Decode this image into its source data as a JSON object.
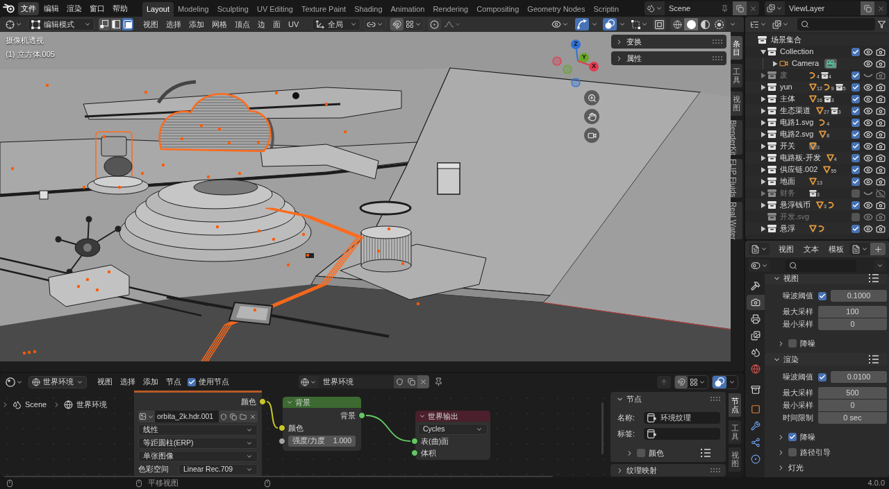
{
  "topbar": {
    "menus": [
      {
        "label": "文件",
        "selected": true
      },
      {
        "label": "编辑",
        "selected": false
      },
      {
        "label": "渲染",
        "selected": false
      },
      {
        "label": "窗口",
        "selected": false
      },
      {
        "label": "帮助",
        "selected": false
      }
    ],
    "workspaces": [
      {
        "label": "Layout",
        "selected": true
      },
      {
        "label": "Modeling",
        "selected": false
      },
      {
        "label": "Sculpting",
        "selected": false
      },
      {
        "label": "UV Editing",
        "selected": false
      },
      {
        "label": "Texture Paint",
        "selected": false
      },
      {
        "label": "Shading",
        "selected": false
      },
      {
        "label": "Animation",
        "selected": false
      },
      {
        "label": "Rendering",
        "selected": false
      },
      {
        "label": "Compositing",
        "selected": false
      },
      {
        "label": "Geometry Nodes",
        "selected": false
      },
      {
        "label": "Scriptin",
        "selected": false
      }
    ],
    "scene": "Scene",
    "view_layer": "ViewLayer"
  },
  "viewport": {
    "header": {
      "mode": "编辑模式",
      "select_modes": [
        {
          "kind": "vertex",
          "selected": false
        },
        {
          "kind": "edge",
          "selected": false
        },
        {
          "kind": "face",
          "selected": true
        }
      ],
      "menus": [
        "视图",
        "选择",
        "添加",
        "网格",
        "顶点",
        "边",
        "面",
        "UV"
      ],
      "orientation": "全局",
      "toggles": [
        {
          "kind": "snap",
          "on": false
        },
        {
          "kind": "proportional",
          "on": false
        },
        {
          "kind": "gizmo",
          "on": true
        },
        {
          "kind": "overlay",
          "on": true
        },
        {
          "kind": "xray",
          "on": false
        }
      ],
      "shading": [
        {
          "kind": "wireframe",
          "selected": false
        },
        {
          "kind": "solid",
          "selected": true
        },
        {
          "kind": "material",
          "selected": false
        },
        {
          "kind": "rendered",
          "selected": false
        }
      ]
    },
    "info": [
      "摄像机透视",
      "(1) 立方体.005"
    ],
    "axes": [
      {
        "label": "Z",
        "color": "#2f71d6"
      },
      {
        "label": "Y",
        "color": "#6aa52a"
      },
      {
        "label": "X",
        "color": "#e23a50"
      }
    ],
    "sidebar_panels": [
      {
        "label": "变换",
        "expanded": false
      },
      {
        "label": "属性",
        "expanded": false
      }
    ],
    "sidebar_tabs": [
      {
        "label": "条目",
        "kind": "stacked",
        "selected": true
      },
      {
        "label": "工具",
        "kind": "stacked",
        "selected": false
      },
      {
        "label": "视图",
        "kind": "stacked",
        "selected": false
      },
      {
        "label": "BlenderKit",
        "kind": "rotated",
        "selected": false
      },
      {
        "label": "FLIP Fluids",
        "kind": "rotated",
        "selected": false
      },
      {
        "label": "Real Water",
        "kind": "rotated",
        "selected": false
      }
    ]
  },
  "node_editor": {
    "header": {
      "world_menu": "世界环境",
      "menus": [
        "视图",
        "选择",
        "添加",
        "节点"
      ],
      "use_nodes": {
        "label": "使用节点",
        "checked": true
      },
      "world": "世界环境",
      "toggles": [
        {
          "kind": "snap",
          "on": false
        },
        {
          "kind": "overlay",
          "on": true
        }
      ]
    },
    "breadcrumb": [
      "Scene",
      "世界环境"
    ],
    "image_node": {
      "output": "颜色",
      "image": "orbita_2k.hdr.001",
      "options": [
        "线性",
        "等距圆柱(ERP)",
        "单张图像"
      ],
      "color_space_label": "色彩空间",
      "color_space": "Linear Rec.709"
    },
    "background_node": {
      "title": "背景",
      "output": "背景",
      "input": "颜色",
      "strength_label": "强度/力度",
      "strength": "1.000"
    },
    "output_node": {
      "title": "世界输出",
      "target": "Cycles",
      "inputs": [
        "表(曲)面",
        "体积"
      ]
    },
    "sidebar": {
      "node_panel": {
        "label": "节点",
        "expanded": true,
        "name_label": "名称:",
        "name": "环境纹理",
        "tag_label": "标签:",
        "color_subpanel": {
          "label": "颜色",
          "checked": false,
          "expanded": false
        }
      },
      "mapping_panel": {
        "label": "纹理映射",
        "expanded": false
      },
      "tabs": [
        {
          "label": "节点",
          "selected": true
        },
        {
          "label": "工具",
          "selected": false
        },
        {
          "label": "视图",
          "selected": false
        }
      ]
    }
  },
  "outliner": {
    "root": "场景集合",
    "items": [
      {
        "label": "Collection",
        "kind": "collection",
        "expanded": true,
        "included": true,
        "visible": true,
        "renderable": true,
        "children": [
          {
            "label": "Camera",
            "kind": "camera",
            "expanded": false,
            "visible": true,
            "renderable": true,
            "contents": [
              {
                "kind": "camera",
                "active": true
              }
            ]
          }
        ]
      },
      {
        "label": "废",
        "kind": "collection",
        "expanded": false,
        "included": true,
        "visible": false,
        "renderable": true,
        "contents": [
          {
            "kind": "curve",
            "count": "4",
            "active": false
          },
          {
            "kind": "collection",
            "count": "4",
            "active": false
          }
        ]
      },
      {
        "label": "yun",
        "kind": "collection",
        "expanded": false,
        "included": true,
        "visible": true,
        "renderable": true,
        "contents": [
          {
            "kind": "mesh",
            "count": "12",
            "active": false
          },
          {
            "kind": "curve",
            "count": "9",
            "active": false
          },
          {
            "kind": "collection",
            "count": "5",
            "active": false
          }
        ]
      },
      {
        "label": "主体",
        "kind": "collection",
        "expanded": false,
        "included": true,
        "visible": true,
        "renderable": true,
        "contents": [
          {
            "kind": "mesh",
            "count": "16",
            "active": false
          },
          {
            "kind": "collection",
            "count": "3",
            "active": false
          }
        ]
      },
      {
        "label": "生态渠道",
        "kind": "collection",
        "expanded": false,
        "included": true,
        "visible": true,
        "renderable": true,
        "contents": [
          {
            "kind": "mesh",
            "count": "27",
            "active": false
          },
          {
            "kind": "collection",
            "count": "3",
            "active": false
          }
        ]
      },
      {
        "label": "电路1.svg",
        "kind": "collection",
        "expanded": false,
        "included": true,
        "visible": true,
        "renderable": true,
        "contents": [
          {
            "kind": "curve",
            "count": "4",
            "active": false
          }
        ]
      },
      {
        "label": "电路2.svg",
        "kind": "collection",
        "expanded": false,
        "included": true,
        "visible": true,
        "renderable": true,
        "contents": [
          {
            "kind": "mesh",
            "count": "8",
            "active": false
          }
        ]
      },
      {
        "label": "开关",
        "kind": "collection",
        "expanded": false,
        "included": true,
        "visible": true,
        "renderable": true,
        "contents": [
          {
            "kind": "mesh",
            "count": "3",
            "active": true
          }
        ]
      },
      {
        "label": "电路板-开发",
        "kind": "collection",
        "expanded": false,
        "included": true,
        "visible": true,
        "renderable": true,
        "contents": [
          {
            "kind": "mesh",
            "count": "4",
            "active": false
          }
        ]
      },
      {
        "label": "供应链.002",
        "kind": "collection",
        "expanded": false,
        "included": true,
        "visible": true,
        "renderable": true,
        "contents": [
          {
            "kind": "mesh",
            "count": "55",
            "active": false
          }
        ]
      },
      {
        "label": "地面",
        "kind": "collection",
        "expanded": false,
        "included": true,
        "visible": true,
        "renderable": true,
        "contents": [
          {
            "kind": "mesh",
            "count": "13",
            "active": false
          }
        ]
      },
      {
        "label": "财务",
        "kind": "collection",
        "expanded": false,
        "included": false,
        "visible": false,
        "renderable": false,
        "contents": [
          {
            "kind": "collection",
            "count": "3",
            "active": false
          }
        ]
      },
      {
        "label": "悬浮钱币",
        "kind": "collection",
        "expanded": false,
        "included": true,
        "visible": true,
        "renderable": true,
        "contents": [
          {
            "kind": "mesh",
            "count": "3",
            "active": false
          },
          {
            "kind": "curve",
            "active": false
          }
        ]
      },
      {
        "label": "开发.svg",
        "kind": "collection",
        "included": false,
        "visible": true,
        "renderable": true
      },
      {
        "label": "悬浮",
        "kind": "collection",
        "expanded": false,
        "included": true,
        "visible": true,
        "renderable": true,
        "contents": [
          {
            "kind": "mesh",
            "active": false
          },
          {
            "kind": "curve",
            "active": false
          }
        ]
      }
    ]
  },
  "properties": {
    "header_menus": [
      "视图",
      "文本",
      "模板"
    ],
    "tabs": [
      {
        "kind": "tool",
        "selected": false
      },
      {
        "kind": "render",
        "selected": true
      },
      {
        "kind": "output",
        "selected": false
      },
      {
        "kind": "view_layer",
        "selected": false
      },
      {
        "kind": "scene",
        "selected": false
      },
      {
        "kind": "world",
        "selected": false
      },
      {
        "kind": "collection",
        "selected": false
      },
      {
        "kind": "object",
        "selected": false
      },
      {
        "kind": "modifier",
        "selected": false
      },
      {
        "kind": "particles",
        "selected": false
      },
      {
        "kind": "physics",
        "selected": false
      }
    ],
    "panels": [
      {
        "label": "视图",
        "expanded": true,
        "rows": [
          {
            "kind": "toggle",
            "label": "噪波阈值",
            "checked": true,
            "value": "0.1000"
          },
          {
            "kind": "number",
            "label": "最大采样",
            "value": "100"
          },
          {
            "kind": "number",
            "label": "最小采样",
            "value": "0"
          }
        ],
        "subpanels": [
          {
            "kind": "toggle",
            "label": "降噪",
            "checked": false,
            "expanded": false
          }
        ]
      },
      {
        "label": "渲染",
        "expanded": true,
        "rows": [
          {
            "kind": "toggle",
            "label": "噪波阈值",
            "checked": true,
            "value": "0.0100"
          },
          {
            "kind": "number",
            "label": "最大采样",
            "value": "500"
          },
          {
            "kind": "number",
            "label": "最小采样",
            "value": "0"
          },
          {
            "kind": "number",
            "label": "时间限制",
            "value": "0 sec"
          }
        ],
        "subpanels": [
          {
            "kind": "toggle",
            "label": "降噪",
            "checked": true,
            "expanded": false
          },
          {
            "kind": "toggle",
            "label": "路径引导",
            "checked": false,
            "expanded": false
          },
          {
            "kind": "plain",
            "label": "灯光",
            "expanded": false
          }
        ]
      }
    ]
  },
  "status_bar": {
    "hint": "平移视图",
    "version": "4.0.0"
  }
}
